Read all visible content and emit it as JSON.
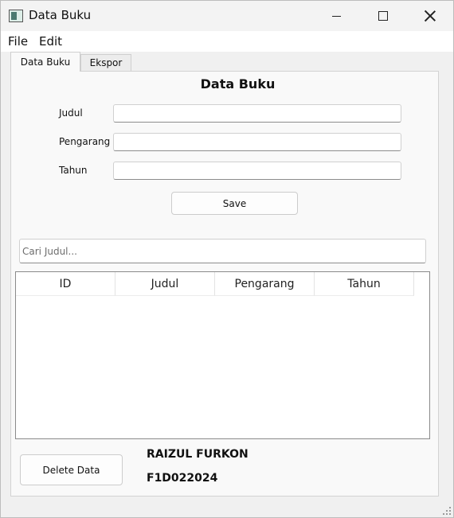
{
  "window": {
    "title": "Data Buku"
  },
  "menu": {
    "file": "File",
    "edit": "Edit"
  },
  "tabs": [
    {
      "label": "Data Buku",
      "active": true
    },
    {
      "label": "Ekspor",
      "active": false
    }
  ],
  "form": {
    "heading": "Data Buku",
    "fields": [
      {
        "label": "Judul",
        "value": ""
      },
      {
        "label": "Pengarang",
        "value": ""
      },
      {
        "label": "Tahun",
        "value": ""
      }
    ],
    "save_label": "Save"
  },
  "search": {
    "placeholder": "Cari Judul...",
    "value": ""
  },
  "table": {
    "columns": [
      "ID",
      "Judul",
      "Pengarang",
      "Tahun"
    ],
    "rows": []
  },
  "footer": {
    "delete_label": "Delete Data",
    "author_name": "RAIZUL FURKON",
    "author_id": "F1D022024"
  },
  "icons": {
    "app": "app-window-icon",
    "minimize": "minimize-icon",
    "maximize": "maximize-icon",
    "close": "close-icon",
    "resize": "resize-grip-icon"
  }
}
